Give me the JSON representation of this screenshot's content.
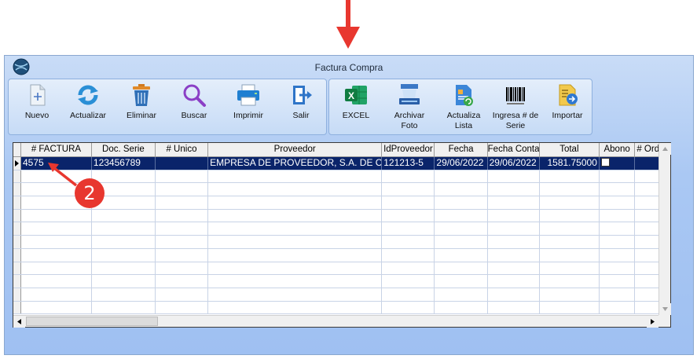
{
  "window": {
    "title": "Factura Compra"
  },
  "toolbar_main": [
    {
      "label": "Nuevo",
      "icon": "new-document-icon"
    },
    {
      "label": "Actualizar",
      "icon": "refresh-icon"
    },
    {
      "label": "Eliminar",
      "icon": "trash-icon"
    },
    {
      "label": "Buscar",
      "icon": "magnifier-icon"
    },
    {
      "label": "Imprimir",
      "icon": "printer-icon"
    },
    {
      "label": "Salir",
      "icon": "exit-icon"
    }
  ],
  "toolbar_extra": [
    {
      "label": "EXCEL",
      "icon": "excel-icon"
    },
    {
      "label": "Archivar Foto",
      "icon": "scanner-icon"
    },
    {
      "label": "Actualiza Lista",
      "icon": "update-list-icon"
    },
    {
      "label": "Ingresa # de Serie",
      "icon": "barcode-icon"
    },
    {
      "label": "Importar",
      "icon": "import-icon"
    }
  ],
  "grid": {
    "columns": [
      "# FACTURA",
      "Doc. Serie",
      "# Unico",
      "Proveedor",
      "IdProveedor",
      "Fecha",
      "Fecha Conta",
      "Total",
      "Abono",
      "# Orde"
    ],
    "rows": [
      [
        "4575",
        "123456789",
        "",
        "EMPRESA DE PROVEEDOR, S.A. DE C.V.",
        "121213-5",
        "29/06/2022",
        "29/06/2022",
        "1581.75000",
        "",
        ""
      ]
    ]
  },
  "callout": {
    "number": "2"
  },
  "colors": {
    "annotation_red": "#e8372f",
    "selection": "#0a246a",
    "window_blue": "#aac8f3"
  }
}
